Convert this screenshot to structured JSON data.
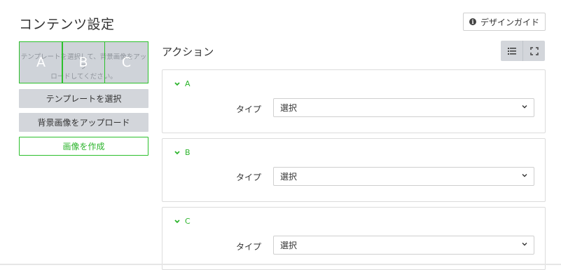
{
  "header": {
    "title": "コンテンツ設定",
    "guide_button": {
      "label": "デザインガイド",
      "icon": "info-icon"
    }
  },
  "preview": {
    "hint": "テンプレートを選択して、背景画像をアップ\nロードしてください。",
    "areas": [
      "A",
      "B",
      "C"
    ],
    "area_border_color": "#2cc02c"
  },
  "left_buttons": {
    "select_template": "テンプレートを選択",
    "upload_background": "背景画像をアップロード",
    "create_image": "画像を作成"
  },
  "actions": {
    "title": "アクション",
    "view_toggle": {
      "list_icon": "list-icon",
      "fullscreen_icon": "fullscreen-icon"
    },
    "items": [
      {
        "label": "A",
        "type_label": "タイプ",
        "select_value": "選択"
      },
      {
        "label": "B",
        "type_label": "タイプ",
        "select_value": "選択"
      },
      {
        "label": "C",
        "type_label": "タイプ",
        "select_value": "選択"
      }
    ]
  },
  "colors": {
    "accent_green": "#2cb42c",
    "button_grey": "#d3d6db"
  }
}
